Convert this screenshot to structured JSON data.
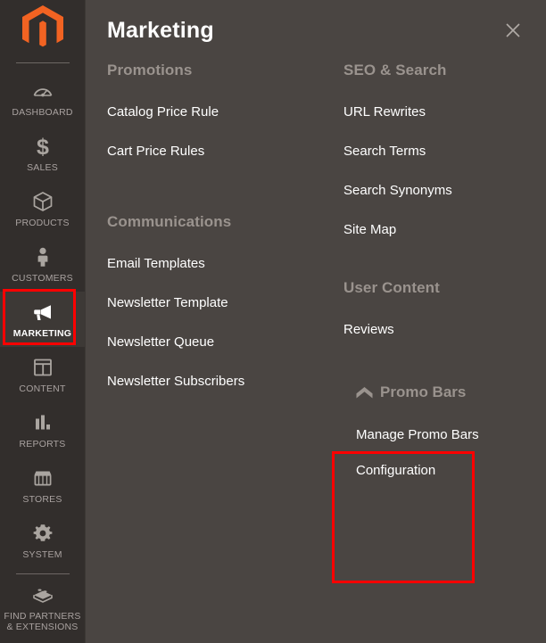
{
  "sidebar": {
    "logo": {
      "icon": "magento-logo-icon",
      "color": "#f26322"
    },
    "items": [
      {
        "label": "DASHBOARD",
        "icon": "dashboard-gauge-icon",
        "active": false
      },
      {
        "label": "SALES",
        "icon": "dollar-sign-icon",
        "active": false
      },
      {
        "label": "PRODUCTS",
        "icon": "box-icon",
        "active": false
      },
      {
        "label": "CUSTOMERS",
        "icon": "person-icon",
        "active": false
      },
      {
        "label": "MARKETING",
        "icon": "megaphone-icon",
        "active": true
      },
      {
        "label": "CONTENT",
        "icon": "layout-page-icon",
        "active": false
      },
      {
        "label": "REPORTS",
        "icon": "bar-chart-icon",
        "active": false
      },
      {
        "label": "STORES",
        "icon": "storefront-icon",
        "active": false
      },
      {
        "label": "SYSTEM",
        "icon": "gear-icon",
        "active": false
      },
      {
        "label": "FIND PARTNERS\n& EXTENSIONS",
        "icon": "lego-brick-icon",
        "active": false
      }
    ]
  },
  "panel": {
    "title": "Marketing",
    "close_icon": "close-icon",
    "left_column": [
      {
        "title": "Promotions",
        "links": [
          "Catalog Price Rule",
          "Cart Price Rules"
        ]
      },
      {
        "title": "Communications",
        "links": [
          "Email Templates",
          "Newsletter Template",
          "Newsletter Queue",
          "Newsletter Subscribers"
        ]
      }
    ],
    "right_column": [
      {
        "title": "SEO & Search",
        "links": [
          "URL Rewrites",
          "Search Terms",
          "Search Synonyms",
          "Site Map"
        ]
      },
      {
        "title": "User Content",
        "links": [
          "Reviews"
        ]
      }
    ],
    "promo_bars": {
      "title": "Promo Bars",
      "icon": "chevron-up-icon",
      "links": [
        "Manage Promo Bars",
        "Configuration"
      ]
    }
  },
  "highlights": {
    "color": "#ff0000",
    "marketing_label": "MARKETING",
    "promo_bars_label": "Promo Bars"
  }
}
